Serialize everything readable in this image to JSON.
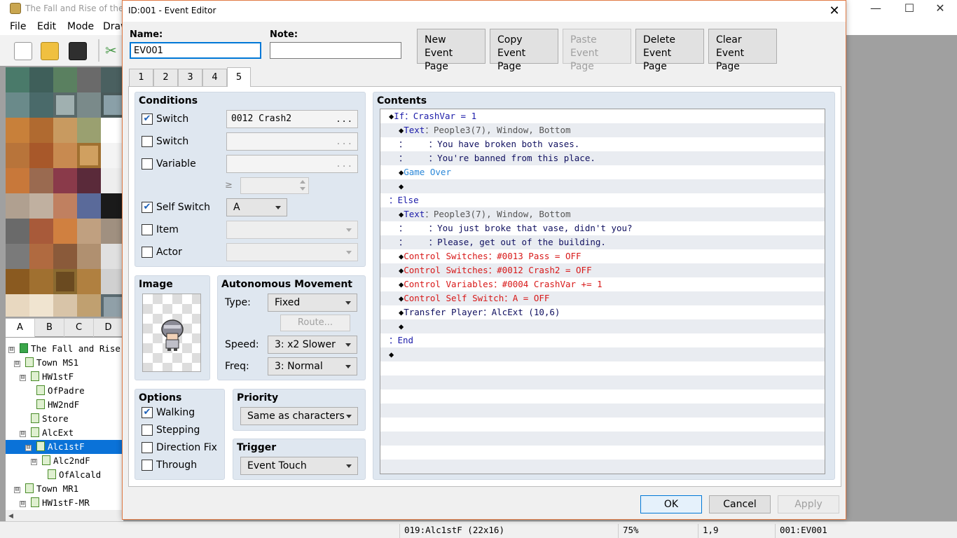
{
  "main": {
    "title": "The Fall and Rise of the Ho",
    "menu": [
      "File",
      "Edit",
      "Mode",
      "Draw"
    ],
    "window_controls": {
      "minimize": "—",
      "maximize": "☐",
      "close": "✕"
    },
    "tileset_tabs": [
      "A",
      "B",
      "C",
      "D"
    ],
    "tree": [
      {
        "label": "The Fall and Rise o",
        "level": 0,
        "expander": "⊟",
        "root": true
      },
      {
        "label": "Town MS1",
        "level": 1,
        "expander": "⊟"
      },
      {
        "label": "HW1stF",
        "level": 2,
        "expander": "⊟"
      },
      {
        "label": "OfPadre",
        "level": 3,
        "expander": ""
      },
      {
        "label": "HW2ndF",
        "level": 3,
        "expander": ""
      },
      {
        "label": "Store",
        "level": 2,
        "expander": ""
      },
      {
        "label": "AlcExt",
        "level": 2,
        "expander": "⊟"
      },
      {
        "label": "Alc1stF",
        "level": 3,
        "expander": "⊟",
        "selected": true
      },
      {
        "label": "Alc2ndF",
        "level": 4,
        "expander": "⊟"
      },
      {
        "label": "OfAlcald",
        "level": 5,
        "expander": ""
      },
      {
        "label": "Town MR1",
        "level": 1,
        "expander": "⊟"
      },
      {
        "label": "HW1stF-MR",
        "level": 2,
        "expander": "⊟"
      }
    ],
    "status": {
      "map": "019:Alc1stF (22x16)",
      "zoom": "75%",
      "coords": "1,9",
      "event": "001:EV001"
    }
  },
  "dialog": {
    "title": "ID:001 - Event Editor",
    "close": "✕",
    "name_label": "Name:",
    "name_value": "EV001",
    "note_label": "Note:",
    "note_value": "",
    "page_buttons": [
      {
        "line1": "New",
        "line2": "Event Page",
        "enabled": true
      },
      {
        "line1": "Copy",
        "line2": "Event Page",
        "enabled": true
      },
      {
        "line1": "Paste",
        "line2": "Event Page",
        "enabled": false
      },
      {
        "line1": "Delete",
        "line2": "Event Page",
        "enabled": true
      },
      {
        "line1": "Clear",
        "line2": "Event Page",
        "enabled": true
      }
    ],
    "page_tabs": [
      "1",
      "2",
      "3",
      "4",
      "5"
    ],
    "active_page": "5",
    "conditions": {
      "title": "Conditions",
      "switch1": {
        "label": "Switch",
        "checked": true,
        "value": "0012 Crash2",
        "dots": "..."
      },
      "switch2": {
        "label": "Switch",
        "checked": false,
        "value": "",
        "dots": "..."
      },
      "variable": {
        "label": "Variable",
        "checked": false,
        "value": "",
        "dots": "...",
        "ge": "≥"
      },
      "self_switch": {
        "label": "Self Switch",
        "checked": true,
        "value": "A"
      },
      "item": {
        "label": "Item",
        "checked": false,
        "value": ""
      },
      "actor": {
        "label": "Actor",
        "checked": false,
        "value": ""
      }
    },
    "image": {
      "title": "Image"
    },
    "autonomous": {
      "title": "Autonomous Movement",
      "type_label": "Type:",
      "type_value": "Fixed",
      "route_label": "Route...",
      "speed_label": "Speed:",
      "speed_value": "3: x2 Slower",
      "freq_label": "Freq:",
      "freq_value": "3: Normal"
    },
    "options": {
      "title": "Options",
      "items": [
        {
          "label": "Walking",
          "checked": true
        },
        {
          "label": "Stepping",
          "checked": false
        },
        {
          "label": "Direction Fix",
          "checked": false
        },
        {
          "label": "Through",
          "checked": false
        }
      ]
    },
    "priority": {
      "title": "Priority",
      "value": "Same as characters"
    },
    "trigger": {
      "title": "Trigger",
      "value": "Event Touch"
    },
    "contents": {
      "title": "Contents",
      "lines": [
        {
          "indent": 0,
          "parts": [
            {
              "t": "◆",
              "c": "black"
            },
            {
              "t": "If：CrashVar = 1",
              "c": "blue"
            }
          ]
        },
        {
          "indent": 1,
          "parts": [
            {
              "t": "◆",
              "c": "black"
            },
            {
              "t": "Text",
              "c": "blue"
            },
            {
              "t": "：People3(7), Window, Bottom",
              "c": "gray"
            }
          ]
        },
        {
          "indent": 1,
          "parts": [
            {
              "t": "：    ：You have broken both vases.",
              "c": "navy"
            }
          ]
        },
        {
          "indent": 1,
          "parts": [
            {
              "t": "：    ：You're banned from this place.",
              "c": "navy"
            }
          ]
        },
        {
          "indent": 1,
          "parts": [
            {
              "t": "◆",
              "c": "black"
            },
            {
              "t": "Game Over",
              "c": "cyan"
            }
          ]
        },
        {
          "indent": 1,
          "parts": [
            {
              "t": "◆",
              "c": "black"
            }
          ]
        },
        {
          "indent": 0,
          "parts": [
            {
              "t": "：Else",
              "c": "blue"
            }
          ]
        },
        {
          "indent": 1,
          "parts": [
            {
              "t": "◆",
              "c": "black"
            },
            {
              "t": "Text",
              "c": "blue"
            },
            {
              "t": "：People3(7), Window, Bottom",
              "c": "gray"
            }
          ]
        },
        {
          "indent": 1,
          "parts": [
            {
              "t": "：    ：You just broke that vase, didn't you?",
              "c": "navy"
            }
          ]
        },
        {
          "indent": 1,
          "parts": [
            {
              "t": "：    ：Please, get out of the building.",
              "c": "navy"
            }
          ]
        },
        {
          "indent": 1,
          "parts": [
            {
              "t": "◆",
              "c": "black"
            },
            {
              "t": "Control Switches：#0013 Pass = OFF",
              "c": "red"
            }
          ]
        },
        {
          "indent": 1,
          "parts": [
            {
              "t": "◆",
              "c": "black"
            },
            {
              "t": "Control Switches：#0012 Crash2 = OFF",
              "c": "red"
            }
          ]
        },
        {
          "indent": 1,
          "parts": [
            {
              "t": "◆",
              "c": "black"
            },
            {
              "t": "Control Variables：#0004 CrashVar += 1",
              "c": "red"
            }
          ]
        },
        {
          "indent": 1,
          "parts": [
            {
              "t": "◆",
              "c": "black"
            },
            {
              "t": "Control Self Switch：A = OFF",
              "c": "red"
            }
          ]
        },
        {
          "indent": 1,
          "parts": [
            {
              "t": "◆",
              "c": "black"
            },
            {
              "t": "Transfer Player：AlcExt (10,6)",
              "c": "navy"
            }
          ]
        },
        {
          "indent": 1,
          "parts": [
            {
              "t": "◆",
              "c": "black"
            }
          ]
        },
        {
          "indent": 0,
          "parts": [
            {
              "t": "：End",
              "c": "blue"
            }
          ]
        },
        {
          "indent": 0,
          "parts": [
            {
              "t": "◆",
              "c": "black"
            }
          ]
        }
      ],
      "total_rows": 26
    },
    "ok": "OK",
    "cancel": "Cancel",
    "apply": "Apply"
  }
}
